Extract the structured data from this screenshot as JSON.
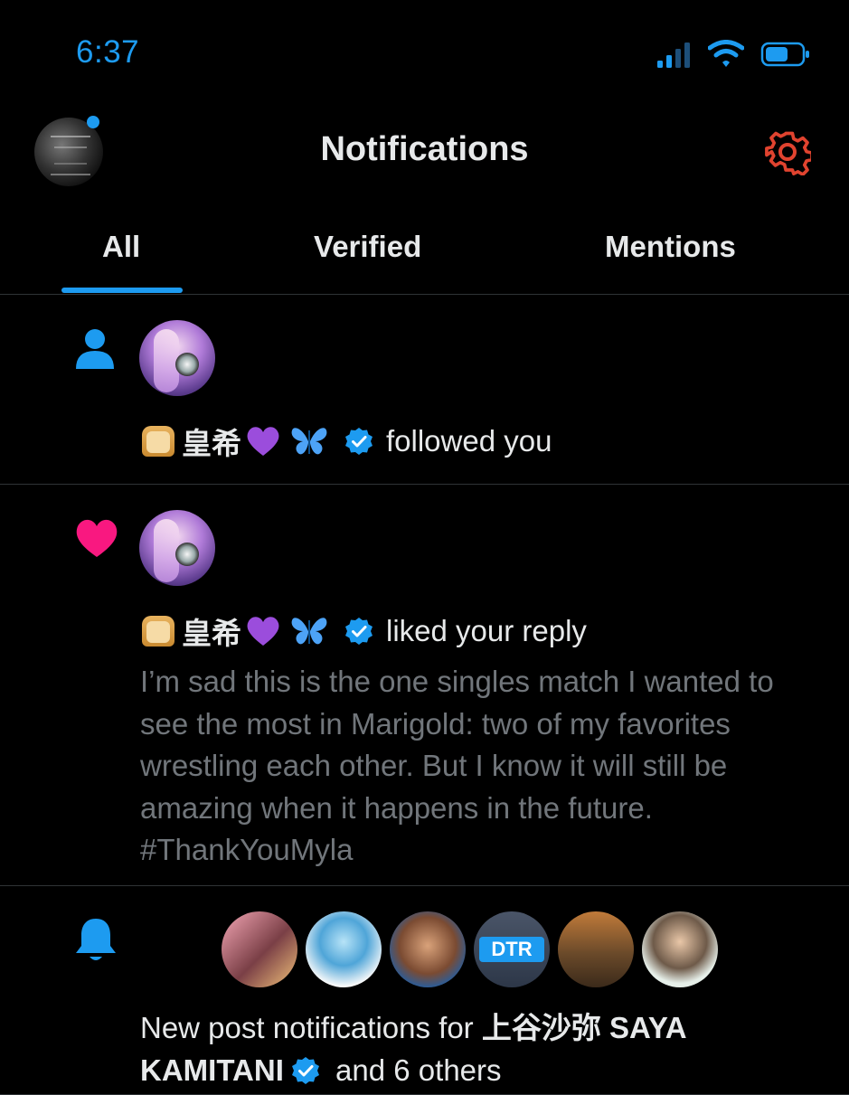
{
  "status_bar": {
    "time": "6:37"
  },
  "header": {
    "title": "Notifications"
  },
  "tabs": [
    {
      "label": "All",
      "active": true
    },
    {
      "label": "Verified",
      "active": false
    },
    {
      "label": "Mentions",
      "active": false
    }
  ],
  "notifications": [
    {
      "type": "follow",
      "icon": "person-icon",
      "user_name": "皇希",
      "emojis": [
        "bread",
        "purple-heart",
        "butterfly"
      ],
      "verified": true,
      "action_text": "followed you"
    },
    {
      "type": "like",
      "icon": "heart-icon",
      "user_name": "皇希",
      "emojis": [
        "bread",
        "purple-heart",
        "butterfly"
      ],
      "verified": true,
      "action_text": "liked your reply",
      "reply_text": "I’m sad this is the one singles match I wanted to see the most in Marigold: two of my favorites wrestling each other. But I know it will still be amazing when it happens in the future. #ThankYouMyla"
    },
    {
      "type": "new-post",
      "icon": "bell-icon",
      "text_prefix": "New post notifications for ",
      "user_name": "上谷沙弥 SAYA KAMITANI",
      "verified": true,
      "text_suffix": " and 6 others",
      "avatar_label_dtr": "DTR"
    }
  ],
  "colors": {
    "accent": "#1d9bf0",
    "heart": "#f91880",
    "gear": "#e0432f",
    "muted_text": "#71767b",
    "divider": "#2f3336"
  }
}
